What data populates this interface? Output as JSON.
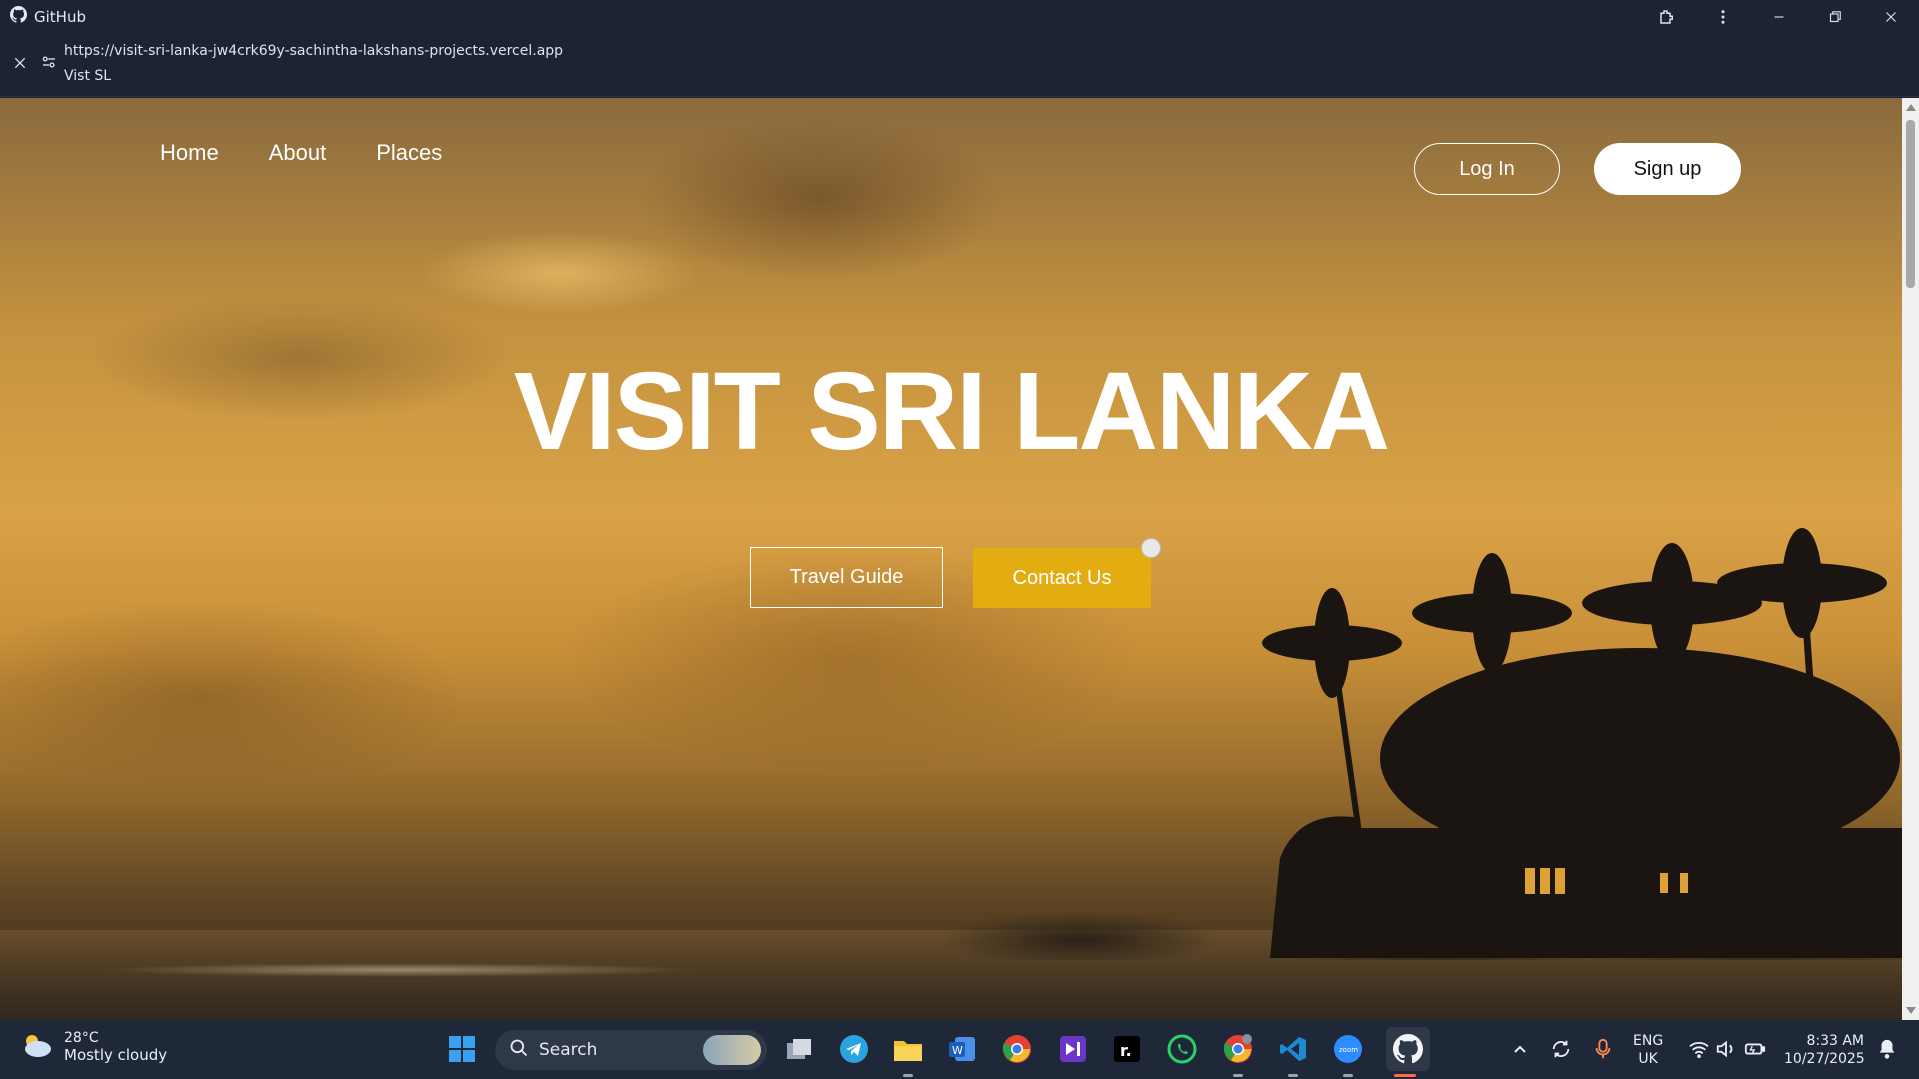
{
  "window": {
    "app_title": "GitHub",
    "url": "https://visit-sri-lanka-jw4crk69y-sachintha-lakshans-projects.vercel.app",
    "page_title": "Vist SL"
  },
  "site": {
    "nav": [
      "Home",
      "About",
      "Places"
    ],
    "login_label": "Log In",
    "signup_label": "Sign up",
    "hero_title": "VISIT SRI LANKA",
    "travel_guide_label": "Travel Guide",
    "contact_label": "Contact Us",
    "accent_color": "#e3ad12"
  },
  "taskbar": {
    "weather_temp": "28°C",
    "weather_condition": "Mostly cloudy",
    "search_label": "Search",
    "language": "ENG",
    "region": "UK",
    "time": "8:33 AM",
    "date": "10/27/2025",
    "apps": [
      "windows-start",
      "task-view",
      "telegram",
      "file-explorer",
      "word",
      "chrome",
      "visual-studio",
      "notion-r",
      "whatsapp",
      "chrome-profile",
      "vscode",
      "zoom",
      "github-desktop"
    ]
  }
}
